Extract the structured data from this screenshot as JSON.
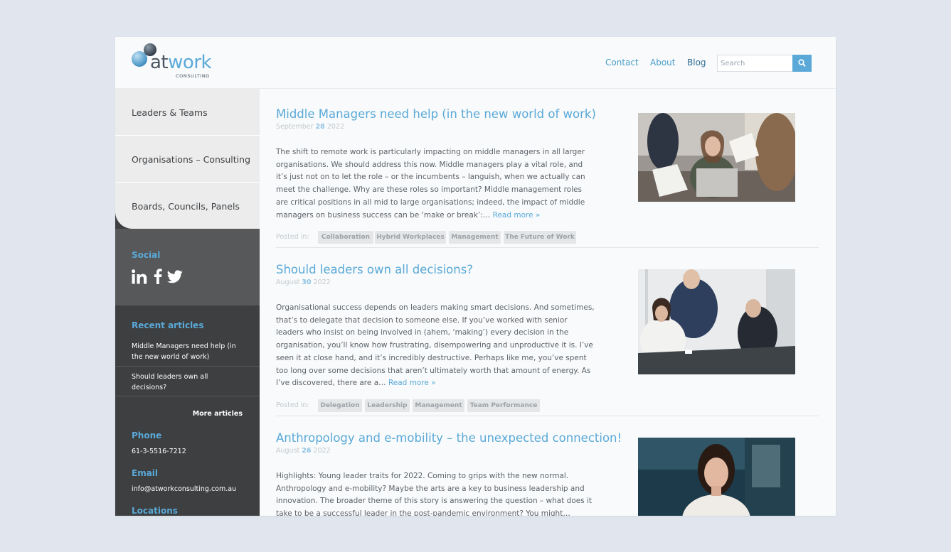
{
  "brand": {
    "logo_main_a": "at",
    "logo_main_b": "work",
    "logo_sub": "CONSULTING"
  },
  "header": {
    "nav": [
      {
        "label": "Contact"
      },
      {
        "label": "About"
      },
      {
        "label": "Blog"
      }
    ],
    "search": {
      "placeholder": "Search"
    }
  },
  "sidebar": {
    "menu": [
      {
        "label": "Leaders & Teams"
      },
      {
        "label": "Organisations – Consulting"
      },
      {
        "label": "Boards, Councils, Panels"
      }
    ],
    "social_heading": "Social",
    "social_icons": [
      "linkedin-icon",
      "facebook-icon",
      "twitter-icon"
    ],
    "recent_heading": "Recent articles",
    "recent": [
      {
        "title": "Middle Managers need help (in the new world of work)"
      },
      {
        "title": "Should leaders own all decisions?"
      }
    ],
    "more_label": "More articles",
    "phone_heading": "Phone",
    "phone": "61-3-5516-7212",
    "email_heading": "Email",
    "email": "info@atworkconsulting.com.au",
    "locations_heading": "Locations"
  },
  "posts": [
    {
      "title": "Middle Managers need help (in the new world of work)",
      "month": "September",
      "day": "28",
      "year": "2022",
      "excerpt": "The shift to remote work is particularly impacting on middle managers in all larger organisations. We should address this now. Middle managers play a vital role, and it’s just not on to let the role – or the incumbents – languish, when we actually can meet the challenge. Why are these roles so important? Middle management roles are critical positions in all mid to large organisations; indeed, the impact of middle managers on business success can be ‘make or break’:…",
      "read_more": "Read more »",
      "posted_in": "Posted in:",
      "tags": [
        "Collaboration",
        "Hybrid Workplaces",
        "Management",
        "The Future of Work"
      ]
    },
    {
      "title": "Should leaders own all decisions?",
      "month": "August",
      "day": "30",
      "year": "2022",
      "excerpt": "Organisational success depends on leaders making smart decisions. And sometimes, that’s to delegate that decision to someone else. If you’ve worked with senior leaders who insist on being involved in (ahem, ‘making’) every decision in the organisation, you’ll know how frustrating, disempowering and unproductive it is. I’ve seen it at close hand, and it’s incredibly destructive. Perhaps like me, you’ve spent too long over some decisions that aren’t ultimately worth that amount of energy. As I’ve discovered, there are a…",
      "read_more": "Read more »",
      "posted_in": "Posted in:",
      "tags": [
        "Delegation",
        "Leadership",
        "Management",
        "Team Performance"
      ]
    },
    {
      "title": "Anthropology and e-mobility – the unexpected connection!",
      "month": "August",
      "day": "26",
      "year": "2022",
      "excerpt": "Highlights: Young leader traits for 2022. Coming to grips with the new normal. Anthropology and e-mobility? Maybe the arts are a key to business leadership and innovation. The broader theme of this story is answering the question – what does it take to be a successful leader in the post-pandemic environment? You might…"
    }
  ]
}
